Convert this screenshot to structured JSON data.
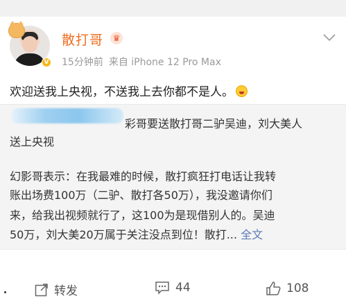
{
  "post": {
    "username": "散打哥",
    "time_ago": "15分钟前",
    "source": "来自 iPhone 12 Pro Max",
    "text": "欢迎送我上央视，不送我上去你都不是人。",
    "verified_badge": "V"
  },
  "repost": {
    "line1": "彩哥要送散打哥二驴吴迪，刘大美人",
    "line2": "送上央视",
    "quote_line1": "幻影哥表示：在我最难的时候，散打疯狂打电话让我转",
    "quote_line2": "账出场费100万（二驴、散打各50万），我没邀请你们",
    "quote_line3": "来，给我出视频就行了，这100为是现借别人的。吴迪",
    "quote_line4_text": "50万，刘大美20万属于关注没点到位！散打...",
    "full_text_link": "全文"
  },
  "actions": {
    "repost_label": "转发",
    "comment_count": "44",
    "like_count": "108"
  },
  "icons": {
    "crown": "crown-icon",
    "menu": "chevron-down-icon",
    "repost": "share-icon",
    "comment": "comment-icon",
    "like": "thumbs-up-icon",
    "emoji": "laughing-emoji-icon"
  },
  "colors": {
    "username": "#f06d1d",
    "link": "#5b7bb4",
    "repost_background": "#f4f4f4"
  }
}
